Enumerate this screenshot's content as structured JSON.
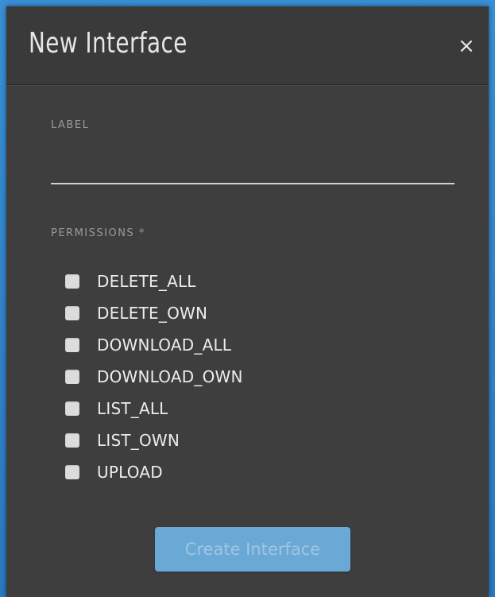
{
  "modal": {
    "title": "New Interface",
    "close_glyph": "×"
  },
  "form": {
    "label_field": {
      "label": "LABEL",
      "value": "",
      "placeholder": ""
    },
    "permissions": {
      "label": "PERMISSIONS *",
      "options": [
        {
          "label": "DELETE_ALL",
          "checked": false
        },
        {
          "label": "DELETE_OWN",
          "checked": false
        },
        {
          "label": "DOWNLOAD_ALL",
          "checked": false
        },
        {
          "label": "DOWNLOAD_OWN",
          "checked": false
        },
        {
          "label": "LIST_ALL",
          "checked": false
        },
        {
          "label": "LIST_OWN",
          "checked": false
        },
        {
          "label": "UPLOAD",
          "checked": false
        }
      ]
    },
    "submit_label": "Create Interface",
    "submit_disabled": true
  },
  "colors": {
    "backdrop": "#2b79c0",
    "modal_bg": "#3e3e3e",
    "button_bg": "#6aa8d6",
    "button_text": "#9fc6e4"
  },
  "icons": {
    "close": "close-icon"
  }
}
